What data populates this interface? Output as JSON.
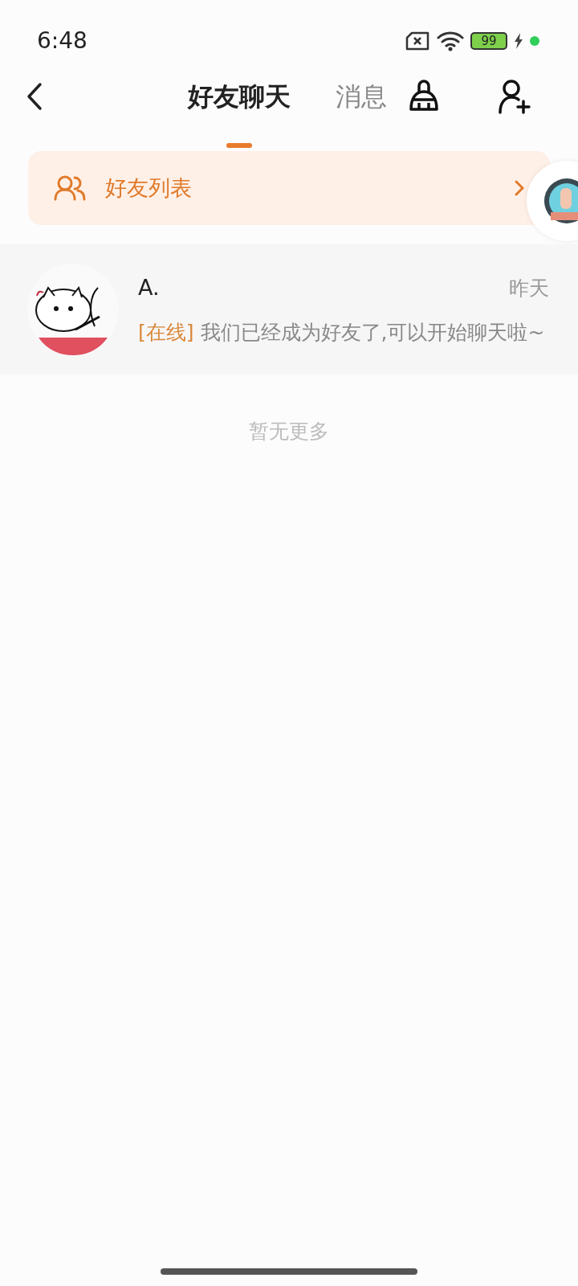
{
  "status_bar": {
    "time": "6:48",
    "battery_text": "99"
  },
  "tabs": [
    {
      "label": "好友聊天",
      "selected": true
    },
    {
      "label": "消息",
      "selected": false
    }
  ],
  "friend_list_link": {
    "label": "好友列表"
  },
  "chats": [
    {
      "name": "A.",
      "time": "昨天",
      "status": "[在线]",
      "message": "我们已经成为好友了,可以开始聊天啦~"
    }
  ],
  "end_note": "暂无更多"
}
